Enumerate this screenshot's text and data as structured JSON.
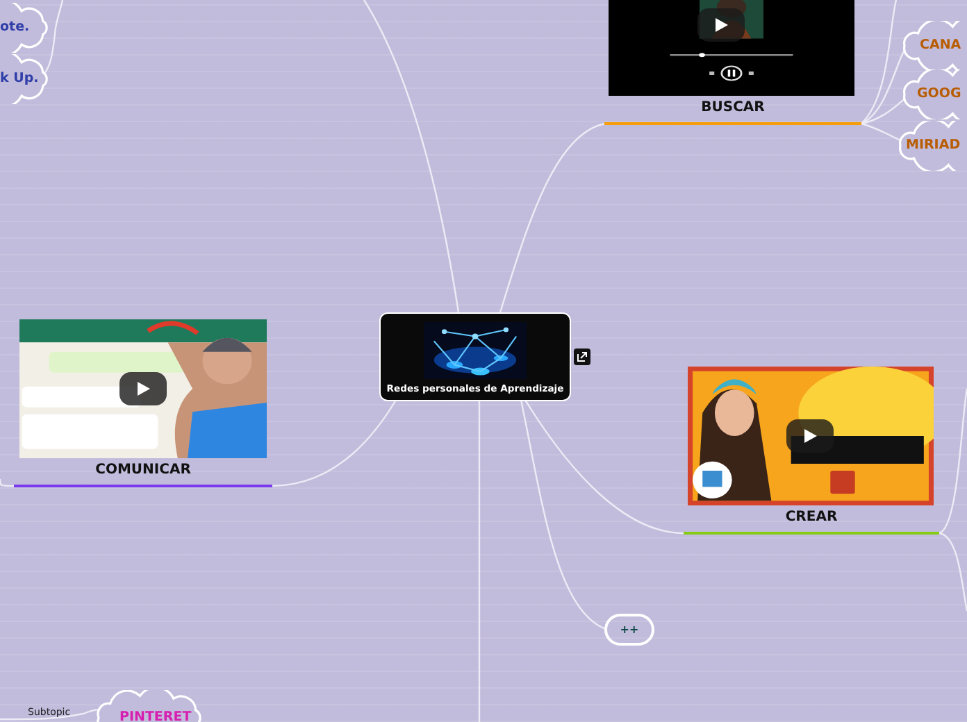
{
  "central_topic": {
    "title": "Redes personales de Aprendizaje"
  },
  "topics": [
    {
      "label": "BUSCAR",
      "color": "#f59e0b"
    },
    {
      "label": "COMUNICAR",
      "color": "#7c3aed"
    },
    {
      "label": "CREAR",
      "color": "#84cc16"
    },
    {
      "label": "++"
    }
  ],
  "subtopics": [
    {
      "label": "ote.",
      "color": "#2f3ea8"
    },
    {
      "label": "k Up.",
      "color": "#2f3ea8"
    },
    {
      "label": "CANA",
      "color": "#b85c00"
    },
    {
      "label": "GOOG",
      "color": "#b85c00"
    },
    {
      "label": "MIRIAD",
      "color": "#b85c00"
    },
    {
      "label": "Subtopic"
    },
    {
      "label": "PINTERET",
      "color": "#d61fb0"
    }
  ]
}
